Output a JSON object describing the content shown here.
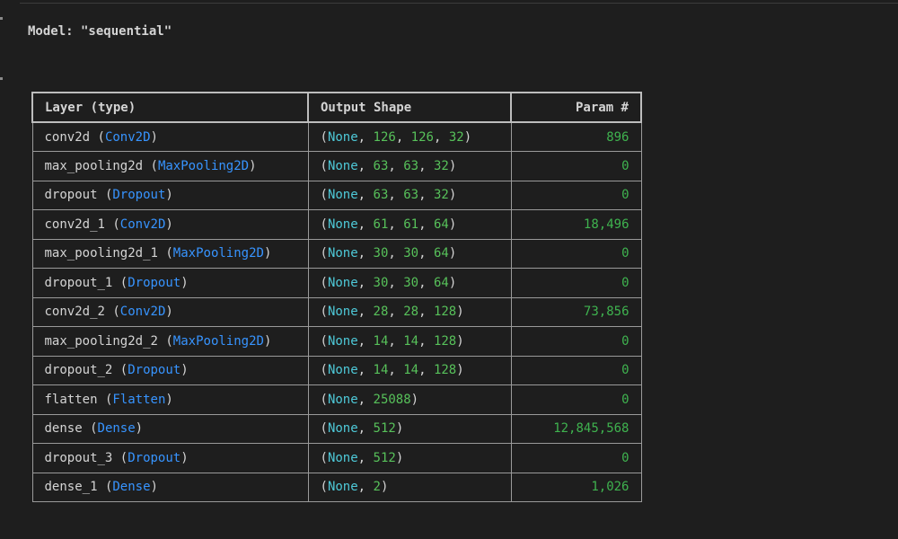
{
  "model_title": "Model: \"sequential\"",
  "table": {
    "headers": [
      "Layer (type)",
      "Output Shape",
      "Param #"
    ],
    "rows": [
      {
        "name": "conv2d",
        "type": "Conv2D",
        "shape": [
          "None",
          "126",
          "126",
          "32"
        ],
        "params": "896"
      },
      {
        "name": "max_pooling2d",
        "type": "MaxPooling2D",
        "shape": [
          "None",
          "63",
          "63",
          "32"
        ],
        "params": "0"
      },
      {
        "name": "dropout",
        "type": "Dropout",
        "shape": [
          "None",
          "63",
          "63",
          "32"
        ],
        "params": "0"
      },
      {
        "name": "conv2d_1",
        "type": "Conv2D",
        "shape": [
          "None",
          "61",
          "61",
          "64"
        ],
        "params": "18,496"
      },
      {
        "name": "max_pooling2d_1",
        "type": "MaxPooling2D",
        "shape": [
          "None",
          "30",
          "30",
          "64"
        ],
        "params": "0"
      },
      {
        "name": "dropout_1",
        "type": "Dropout",
        "shape": [
          "None",
          "30",
          "30",
          "64"
        ],
        "params": "0"
      },
      {
        "name": "conv2d_2",
        "type": "Conv2D",
        "shape": [
          "None",
          "28",
          "28",
          "128"
        ],
        "params": "73,856"
      },
      {
        "name": "max_pooling2d_2",
        "type": "MaxPooling2D",
        "shape": [
          "None",
          "14",
          "14",
          "128"
        ],
        "params": "0"
      },
      {
        "name": "dropout_2",
        "type": "Dropout",
        "shape": [
          "None",
          "14",
          "14",
          "128"
        ],
        "params": "0"
      },
      {
        "name": "flatten",
        "type": "Flatten",
        "shape": [
          "None",
          "25088"
        ],
        "params": "0"
      },
      {
        "name": "dense",
        "type": "Dense",
        "shape": [
          "None",
          "512"
        ],
        "params": "12,845,568"
      },
      {
        "name": "dropout_3",
        "type": "Dropout",
        "shape": [
          "None",
          "512"
        ],
        "params": "0"
      },
      {
        "name": "dense_1",
        "type": "Dense",
        "shape": [
          "None",
          "2"
        ],
        "params": "1,026"
      }
    ]
  },
  "colors": {
    "background": "#1e1e1e",
    "text": "#d4d4d4",
    "class_name": "#3794ff",
    "none_keyword": "#4ec9d8",
    "number": "#57c15a",
    "param_count": "#3fb34f",
    "border": "#9a9a9a"
  }
}
